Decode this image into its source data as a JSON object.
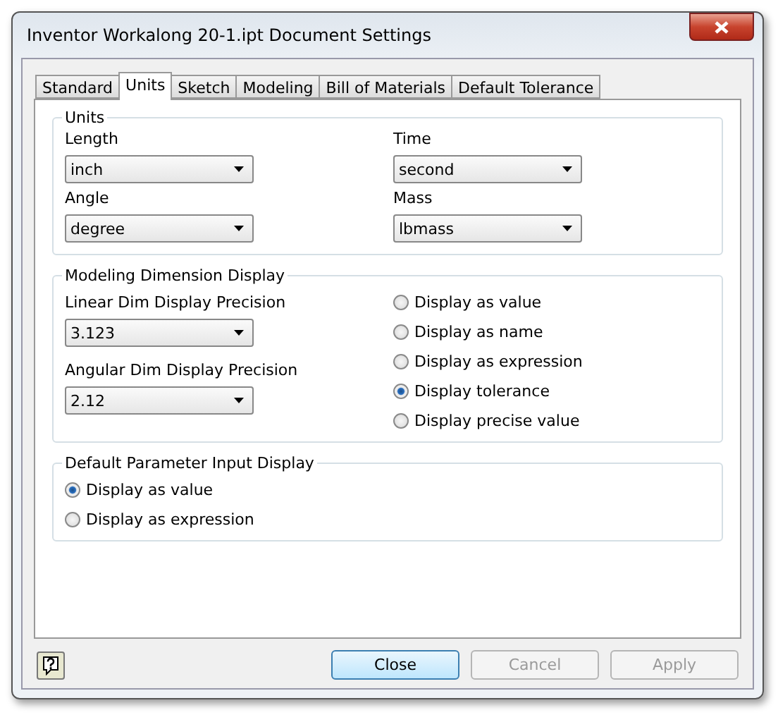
{
  "window": {
    "title": "Inventor Workalong 20-1.ipt Document Settings"
  },
  "tabs": [
    {
      "label": "Standard",
      "selected": false
    },
    {
      "label": "Units",
      "selected": true
    },
    {
      "label": "Sketch",
      "selected": false
    },
    {
      "label": "Modeling",
      "selected": false
    },
    {
      "label": "Bill of Materials",
      "selected": false
    },
    {
      "label": "Default Tolerance",
      "selected": false
    }
  ],
  "units": {
    "title": "Units",
    "fields": [
      {
        "label": "Length",
        "value": "inch"
      },
      {
        "label": "Time",
        "value": "second"
      },
      {
        "label": "Angle",
        "value": "degree"
      },
      {
        "label": "Mass",
        "value": "lbmass"
      }
    ]
  },
  "modeling_dimension_display": {
    "title": "Modeling Dimension Display",
    "fields": [
      {
        "label": "Linear Dim Display Precision",
        "value": "3.123"
      },
      {
        "label": "Angular Dim Display Precision",
        "value": "2.12"
      }
    ],
    "options": [
      {
        "label": "Display as value",
        "selected": false
      },
      {
        "label": "Display as name",
        "selected": false
      },
      {
        "label": "Display as expression",
        "selected": false
      },
      {
        "label": "Display tolerance",
        "selected": true
      },
      {
        "label": "Display precise value",
        "selected": false
      }
    ]
  },
  "default_parameter_input_display": {
    "title": "Default Parameter Input Display",
    "options": [
      {
        "label": "Display as value",
        "selected": true
      },
      {
        "label": "Display as expression",
        "selected": false
      }
    ]
  },
  "buttons": [
    {
      "label": "Close",
      "disabled": false,
      "default": true
    },
    {
      "label": "Cancel",
      "disabled": true,
      "default": false
    },
    {
      "label": "Apply",
      "disabled": true,
      "default": false
    }
  ]
}
